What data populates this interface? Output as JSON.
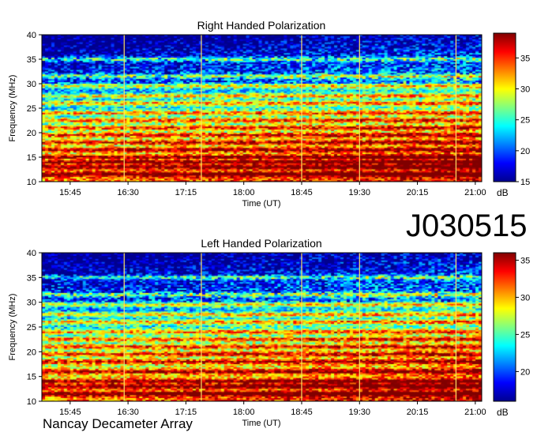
{
  "figure_id": "J030515",
  "footer": "Nancay Decameter Array",
  "chart_data": [
    {
      "type": "heatmap",
      "title": "Right Handed Polarization",
      "xlabel": "Time (UT)",
      "ylabel": "Frequency (MHz)",
      "x_ticks": [
        "15:45",
        "16:30",
        "17:15",
        "18:00",
        "18:45",
        "19:30",
        "20:15",
        "21:00"
      ],
      "xlim": [
        "15:23",
        "21:05"
      ],
      "y_ticks": [
        10,
        15,
        20,
        25,
        30,
        35,
        40
      ],
      "ylim": [
        10,
        40
      ],
      "colorbar": {
        "label": "dB",
        "ticks": [
          15,
          20,
          25,
          30,
          35
        ],
        "range": [
          15,
          39
        ]
      },
      "bright_frequency_bands_mhz": [
        11.5,
        13,
        14,
        15,
        16.5,
        18,
        19.5,
        21,
        22.5,
        24,
        26,
        27.5,
        29.5,
        31.5,
        35
      ],
      "vertical_lines_ut": [
        "16:27",
        "17:27",
        "18:45",
        "19:30",
        "20:45"
      ],
      "colorscale": [
        "#00008f",
        "#0000ff",
        "#0080ff",
        "#00ffff",
        "#80ff80",
        "#ffff00",
        "#ff8000",
        "#ff0000",
        "#800000"
      ]
    },
    {
      "type": "heatmap",
      "title": "Left Handed Polarization",
      "xlabel": "Time (UT)",
      "ylabel": "Frequency (MHz)",
      "x_ticks": [
        "15:45",
        "16:30",
        "17:15",
        "18:00",
        "18:45",
        "19:30",
        "20:15",
        "21:00"
      ],
      "xlim": [
        "15:23",
        "21:05"
      ],
      "y_ticks": [
        10,
        15,
        20,
        25,
        30,
        35,
        40
      ],
      "ylim": [
        10,
        40
      ],
      "colorbar": {
        "label": "dB",
        "ticks": [
          20,
          25,
          30,
          35
        ],
        "range": [
          16,
          36
        ]
      },
      "bright_frequency_bands_mhz": [
        11.5,
        13,
        14,
        16,
        18,
        19.5,
        21,
        22.5,
        24,
        26,
        27.5,
        29.5,
        31.5,
        35
      ],
      "vertical_lines_ut": [
        "16:27",
        "17:27",
        "18:45",
        "19:30",
        "20:45"
      ],
      "colorscale": [
        "#00008f",
        "#0000ff",
        "#0080ff",
        "#00ffff",
        "#80ff80",
        "#ffff00",
        "#ff8000",
        "#ff0000",
        "#800000"
      ]
    }
  ]
}
